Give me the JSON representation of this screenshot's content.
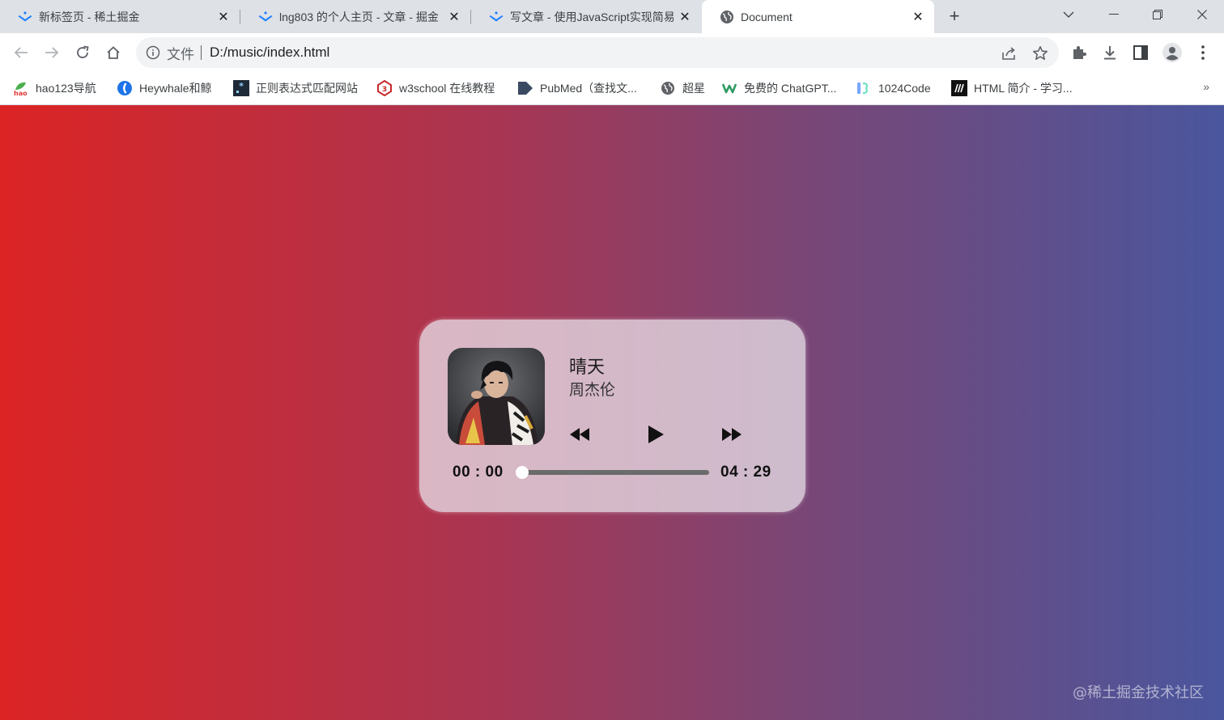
{
  "browser": {
    "tabs": [
      {
        "title": "新标签页 - 稀土掘金",
        "icon": "juejin-logo-icon"
      },
      {
        "title": "lng803 的个人主页 - 文章 - 掘金",
        "icon": "juejin-logo-icon"
      },
      {
        "title": "写文章 - 使用JavaScript实现简易",
        "icon": "juejin-logo-icon"
      },
      {
        "title": "Document",
        "icon": "globe-icon",
        "active": true
      }
    ],
    "address": {
      "scheme": "文件",
      "url": "D:/music/index.html"
    },
    "bookmarks": [
      {
        "label": "hao123导航",
        "icon": "hao123-icon"
      },
      {
        "label": "Heywhale和鲸",
        "icon": "heywhale-icon"
      },
      {
        "label": "正则表达式匹配网站",
        "icon": "regex-icon"
      },
      {
        "label": "w3school 在线教程",
        "icon": "w3school-icon"
      },
      {
        "label": "PubMed（查找文...",
        "icon": "pubmed-icon"
      },
      {
        "label": "超星",
        "icon": "globe-icon"
      },
      {
        "label": "免费的 ChatGPT...",
        "icon": "chatgpt-icon"
      },
      {
        "label": "1024Code",
        "icon": "code-icon"
      },
      {
        "label": "HTML 简介 - 学习...",
        "icon": "mdn-icon"
      }
    ],
    "bookmarks_more": "»"
  },
  "player": {
    "title": "晴天",
    "artist": "周杰伦",
    "current_time": "00 : 00",
    "total_time": "04 : 29",
    "progress": 0,
    "playing": false
  },
  "watermark": "@稀土掘金技术社区",
  "colors": {
    "gradient_start": "#dc2424",
    "gradient_end": "#4a569d",
    "card_bg": "rgba(230,220,230,0.78)"
  }
}
